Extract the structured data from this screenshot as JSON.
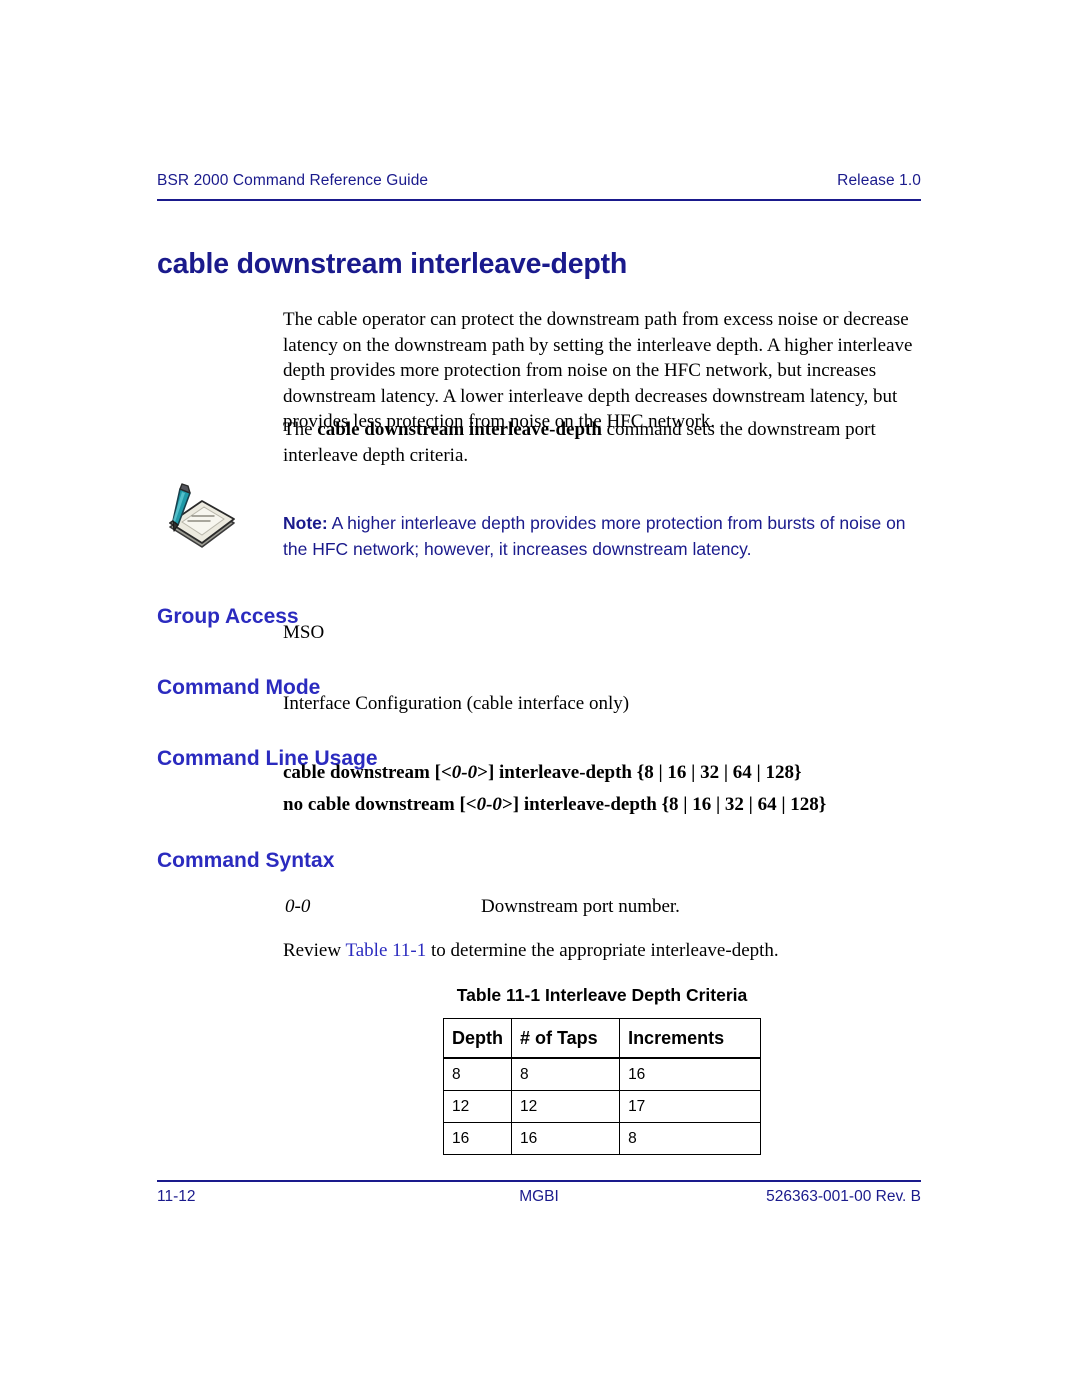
{
  "header": {
    "left": "BSR 2000 Command Reference Guide",
    "right": "Release 1.0"
  },
  "title": "cable downstream interleave-depth",
  "paragraphs": {
    "p1": "The cable operator can protect the downstream path from excess noise or decrease latency on the downstream path by setting the interleave depth. A higher interleave depth provides more protection from noise on the HFC network, but increases downstream latency. A lower interleave depth decreases downstream latency, but provides less protection from noise on the HFC network.",
    "p2_pre": "The ",
    "p2_cmd": "cable downstream interleave-depth",
    "p2_post": " command sets the downstream port interleave depth criteria."
  },
  "note": {
    "icon": "note-pencil-pad-icon",
    "label": "Note:",
    "text": " A higher interleave depth provides more protection from bursts of noise on the HFC network; however, it increases downstream latency."
  },
  "sections": {
    "group_access": {
      "heading": "Group Access",
      "body": "MSO"
    },
    "command_mode": {
      "heading": "Command Mode",
      "body": "Interface Configuration (cable interface only)"
    },
    "command_line_usage": {
      "heading": "Command Line Usage",
      "line1_a": "cable downstream [<",
      "line1_var": "0-0",
      "line1_b": ">] interleave-depth {8 | 16 | 32 | 64 | 128}",
      "line2_a": "no cable downstream [<",
      "line2_var": "0-0",
      "line2_b": ">] interleave-depth {8 | 16 | 32 | 64 | 128}"
    },
    "command_syntax": {
      "heading": "Command Syntax",
      "param_name": "0-0",
      "param_desc": "Downstream port number.",
      "review_pre": "Review ",
      "review_xref": "Table 11-1",
      "review_post": " to determine the appropriate interleave-depth."
    }
  },
  "table": {
    "caption": "Table 11-1  Interleave Depth Criteria",
    "columns": [
      "Depth",
      "# of Taps",
      "Increments"
    ],
    "rows": [
      [
        "8",
        "8",
        "16"
      ],
      [
        "12",
        "12",
        "17"
      ],
      [
        "16",
        "16",
        "8"
      ]
    ]
  },
  "footer": {
    "page_number": "11-12",
    "center": "MGBI",
    "doc_number": "526363-001-00 Rev. B"
  },
  "colors": {
    "navy": "#1a1a8c",
    "heading_blue": "#2b2bbf",
    "text_black": "#000000",
    "pen_teal": "#1f9aa8"
  }
}
